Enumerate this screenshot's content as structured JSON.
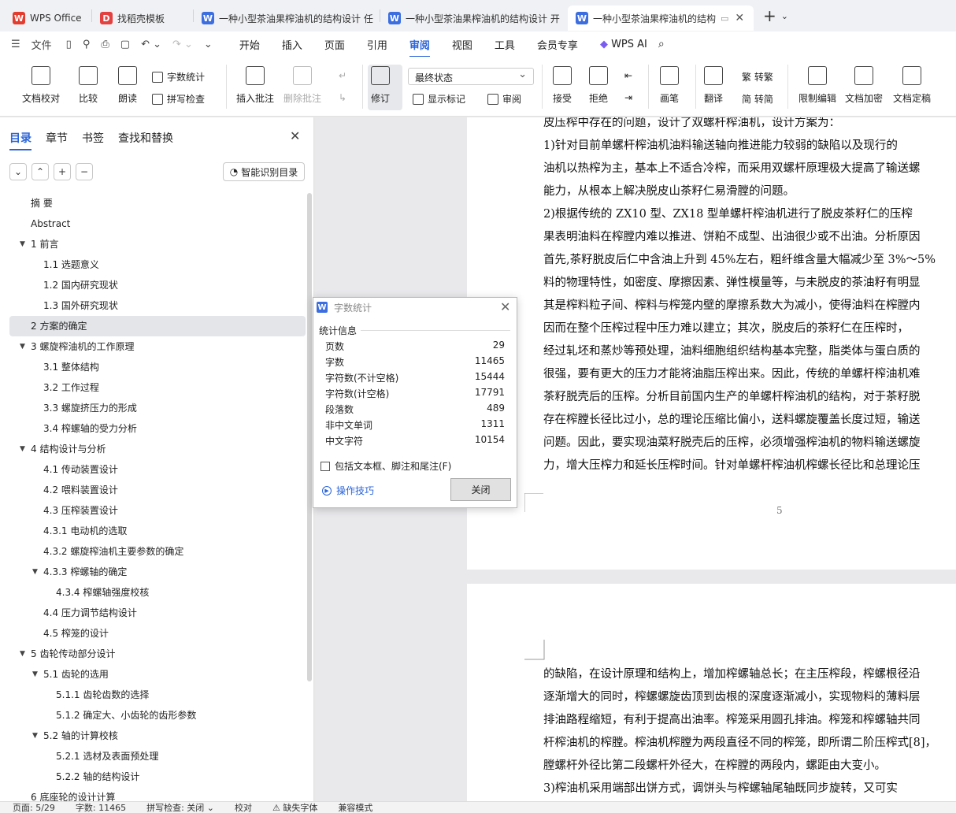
{
  "tabs": [
    {
      "label": "WPS Office",
      "icon": "wps-logo-icon",
      "color": "#e33b2e"
    },
    {
      "label": "找稻壳模板",
      "icon": "docer-icon",
      "color": "#e34040"
    },
    {
      "label": "一种小型茶油果榨油机的结构设计 任",
      "icon": "w-doc-icon",
      "color": "#3c6ee0"
    },
    {
      "label": "一种小型茶油果榨油机的结构设计 开",
      "icon": "w-doc-icon",
      "color": "#3c6ee0"
    },
    {
      "label": "一种小型茶油果榨油机的结构",
      "icon": "w-doc-icon",
      "color": "#3c6ee0"
    }
  ],
  "menubar": {
    "file": "文件",
    "items": [
      "开始",
      "插入",
      "页面",
      "引用",
      "审阅",
      "视图",
      "工具",
      "会员专享"
    ],
    "active": "审阅",
    "wps_ai": "WPS AI"
  },
  "ribbon": {
    "doc_proof": "文档校对",
    "compare": "比较",
    "read_aloud": "朗读",
    "word_count": "字数统计",
    "spell_check": "拼写检查",
    "insert_comment": "插入批注",
    "delete_comment": "删除批注",
    "track": "修订",
    "status_select": "最终状态",
    "show_markup": "显示标记",
    "review": "审阅",
    "accept": "接受",
    "reject": "拒绝",
    "pen": "画笔",
    "translate": "翻译",
    "to_traditional": "繁 转繁",
    "to_simplified": "简 转简",
    "restrict_edit": "限制编辑",
    "encrypt": "文档加密",
    "finalize": "文档定稿"
  },
  "panel": {
    "tabs": [
      "目录",
      "章节",
      "书签",
      "查找和替换"
    ],
    "smart_toc": "智能识别目录",
    "toc": [
      {
        "label": "摘  要",
        "level": 1,
        "arrow": false
      },
      {
        "label": "Abstract",
        "level": 1,
        "arrow": false
      },
      {
        "label": "1   前言",
        "level": 1,
        "arrow": true
      },
      {
        "label": "1.1   选题意义",
        "level": 2,
        "arrow": false
      },
      {
        "label": "1.2   国内研究现状",
        "level": 2,
        "arrow": false
      },
      {
        "label": "1.3   国外研究现状",
        "level": 2,
        "arrow": false
      },
      {
        "label": "2   方案的确定",
        "level": 1,
        "arrow": false,
        "selected": true
      },
      {
        "label": "3   螺旋榨油机的工作原理",
        "level": 1,
        "arrow": true
      },
      {
        "label": "3.1   整体结构",
        "level": 2,
        "arrow": false
      },
      {
        "label": "3.2   工作过程",
        "level": 2,
        "arrow": false
      },
      {
        "label": "3.3   螺旋挤压力的形成",
        "level": 2,
        "arrow": false
      },
      {
        "label": "3.4   榨螺轴的受力分析",
        "level": 2,
        "arrow": false
      },
      {
        "label": "4   结构设计与分析",
        "level": 1,
        "arrow": true
      },
      {
        "label": "4.1   传动装置设计",
        "level": 2,
        "arrow": false
      },
      {
        "label": "4.2   喂料装置设计",
        "level": 2,
        "arrow": false
      },
      {
        "label": "4.3   压榨装置设计",
        "level": 2,
        "arrow": false
      },
      {
        "label": "4.3.1   电动机的选取",
        "level": 2,
        "arrow": false
      },
      {
        "label": "4.3.2   螺旋榨油机主要参数的确定",
        "level": 2,
        "arrow": false
      },
      {
        "label": "4.3.3   榨螺轴的确定",
        "level": 2,
        "arrow": true
      },
      {
        "label": "4.3.4   榨螺轴强度校核",
        "level": 3,
        "arrow": false
      },
      {
        "label": "4.4   压力调节结构设计",
        "level": 2,
        "arrow": false
      },
      {
        "label": "4.5 榨笼的设计",
        "level": 2,
        "arrow": false
      },
      {
        "label": "5   齿轮传动部分设计",
        "level": 1,
        "arrow": true
      },
      {
        "label": "5.1   齿轮的选用",
        "level": 2,
        "arrow": true
      },
      {
        "label": "5.1.1   齿轮齿数的选择",
        "level": 3,
        "arrow": false
      },
      {
        "label": "5.1.2   确定大、小齿轮的齿形参数",
        "level": 3,
        "arrow": false
      },
      {
        "label": "5.2   轴的计算校核",
        "level": 2,
        "arrow": true
      },
      {
        "label": "5.2.1   选材及表面预处理",
        "level": 3,
        "arrow": false
      },
      {
        "label": "5.2.2   轴的结构设计",
        "level": 3,
        "arrow": false
      },
      {
        "label": "6   底座轮的设计计算",
        "level": 1,
        "arrow": false
      }
    ]
  },
  "document": {
    "page1_lines": [
      "皮压榨中存在的问题，设计了双螺杆榨油机，设计方案为：",
      "    1)针对目前单螺杆榨油机油料输送轴向推进能力较弱的缺陷以及现行的",
      "油机以热榨为主，基本上不适合冷榨，而采用双螺杆原理极大提高了输送螺",
      "能力，从根本上解决脱皮山茶籽仁易滑膛的问题。",
      "    2)根据传统的 ZX10 型、ZX18 型单螺杆榨油机进行了脱皮茶籽仁的压榨",
      "果表明油料在榨膛内难以推进、饼粕不成型、出油很少或不出油。分析原因",
      "首先,茶籽脱皮后仁中含油上升到 45%左右，粗纤维含量大幅减少至 3%～5%",
      "料的物理特性，如密度、摩擦因素、弹性模量等，与未脱皮的茶油籽有明显",
      "其是榨料粒子间、榨料与榨笼内壁的摩擦系数大为减小，使得油料在榨膛内",
      "因而在整个压榨过程中压力难以建立；其次，脱皮后的茶籽仁在压榨时，",
      "经过轧坯和蒸炒等预处理，油料细胞组织结构基本完整，脂类体与蛋白质的",
      "很强，要有更大的压力才能将油脂压榨出来。因此，传统的单螺杆榨油机难",
      "茶籽脱壳后的压榨。分析目前国内生产的单螺杆榨油机的结构，对于茶籽脱",
      "存在榨膛长径比过小，总的理论压缩比偏小，送料螺旋覆盖长度过短，输送",
      "问题。因此，要实现油菜籽脱壳后的压榨，必须增强榨油机的物料输送螺旋",
      "力，增大压榨力和延长压榨时间。针对单螺杆榨油机榨螺长径比和总理论压"
    ],
    "page_number": "5",
    "page2_lines": [
      "的缺陷，在设计原理和结构上，增加榨螺轴总长；在主压榨段，榨螺根径沿",
      "逐渐增大的同时，榨螺螺旋齿顶到齿根的深度逐渐减小，实现物料的薄料层",
      "排油路程缩短，有利于提高出油率。榨笼采用圆孔排油。榨笼和榨螺轴共同",
      "杆榨油机的榨膛。榨油机榨膛为两段直径不同的榨笼，即所谓二阶压榨式[8]，",
      "膛螺杆外径比第二段螺杆外径大，在榨膛的两段内，螺距由大变小。",
      "    3)榨油机采用端部出饼方式，调饼头与榨螺轴尾轴既同步旋转，又可实"
    ]
  },
  "dialog": {
    "title": "字数统计",
    "section": "统计信息",
    "stats": [
      {
        "label": "页数",
        "value": "29"
      },
      {
        "label": "字数",
        "value": "11465"
      },
      {
        "label": "字符数(不计空格)",
        "value": "15444"
      },
      {
        "label": "字符数(计空格)",
        "value": "17791"
      },
      {
        "label": "段落数",
        "value": "489"
      },
      {
        "label": "非中文单词",
        "value": "1311"
      },
      {
        "label": "中文字符",
        "value": "10154"
      }
    ],
    "include_label": "包括文本框、脚注和尾注(F)",
    "include_checked": false,
    "tips": "操作技巧",
    "close": "关闭"
  },
  "statusbar": {
    "page": "页面: 5/29",
    "words": "字数: 11465",
    "spell": "拼写检查: 关闭 ⌄",
    "proof": "校对",
    "missing_font": "⚠ 缺失字体",
    "compat": "兼容模式"
  }
}
